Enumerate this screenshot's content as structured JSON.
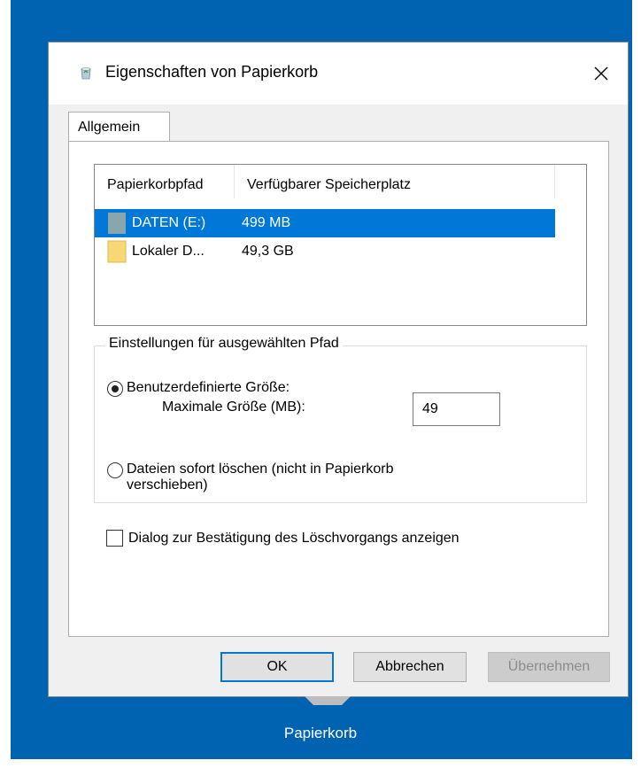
{
  "dialog": {
    "title": "Eigenschaften von Papierkorb",
    "tab_label": "Allgemein",
    "columns": [
      "Papierkorbpfad",
      "Verfügbarer Speicherplatz"
    ],
    "rows": [
      {
        "name": "DATEN (E:)",
        "space": "499 MB",
        "selected": true,
        "icon": "drive-icon"
      },
      {
        "name": "Lokaler D...",
        "space": "49,3 GB",
        "selected": false,
        "icon": "folder-icon"
      }
    ],
    "group": {
      "legend": "Einstellungen für ausgewählten Pfad",
      "radio_custom_label": "Benutzerdefinierte Größe:",
      "maxsize_label": "Maximale Größe (MB):",
      "maxsize_value": "49",
      "radio_delete_line1": "Dateien sofort löschen (nicht in Papierkorb",
      "radio_delete_line2": "verschieben)",
      "selected_option": "custom"
    },
    "confirm_checkbox_label": "Dialog zur Bestätigung des Löschvorgangs anzeigen",
    "confirm_checked": false,
    "buttons": {
      "ok": "OK",
      "cancel": "Abbrechen",
      "apply": "Übernehmen"
    }
  },
  "desktop": {
    "icon_label": "Papierkorb"
  },
  "colors": {
    "desktop": "#0063b1",
    "selection": "#0078d7"
  }
}
